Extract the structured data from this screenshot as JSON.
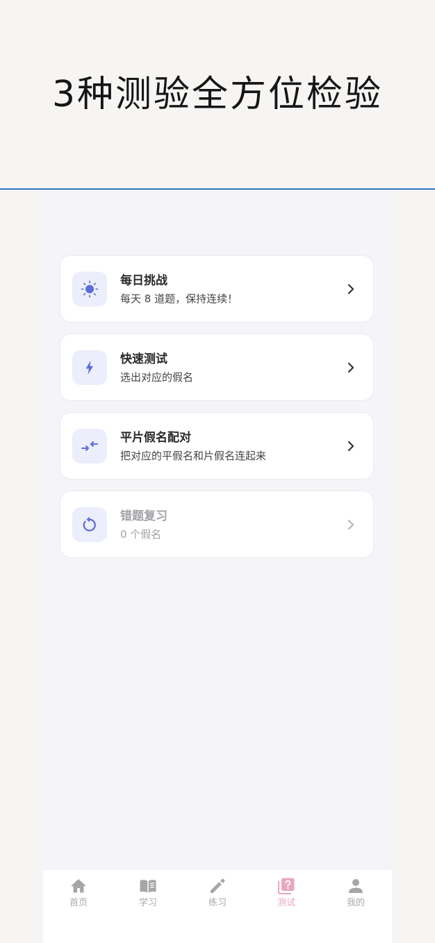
{
  "headline": "3种测验全方位检验",
  "colors": {
    "accent": "#5b6cd8",
    "divider": "#2f77c4",
    "tab_active": "#e8a9bd",
    "tab_inactive": "#a9a9a9"
  },
  "cards": [
    {
      "title": "每日挑战",
      "subtitle": "每天 8 道题，保持连续！",
      "icon": "sun-icon",
      "enabled": true
    },
    {
      "title": "快速测试",
      "subtitle": "选出对应的假名",
      "icon": "lightning-icon",
      "enabled": true
    },
    {
      "title": "平片假名配对",
      "subtitle": "把对应的平假名和片假名连起来",
      "icon": "swap-arrows-icon",
      "enabled": true
    },
    {
      "title": "错题复习",
      "subtitle": "0 个假名",
      "icon": "refresh-icon",
      "enabled": false
    }
  ],
  "tabs": [
    {
      "label": "首页",
      "icon": "home-icon",
      "active": false
    },
    {
      "label": "学习",
      "icon": "book-icon",
      "active": false
    },
    {
      "label": "练习",
      "icon": "pencil-icon",
      "active": false
    },
    {
      "label": "测试",
      "icon": "quiz-icon",
      "active": true
    },
    {
      "label": "我的",
      "icon": "person-icon",
      "active": false
    }
  ]
}
